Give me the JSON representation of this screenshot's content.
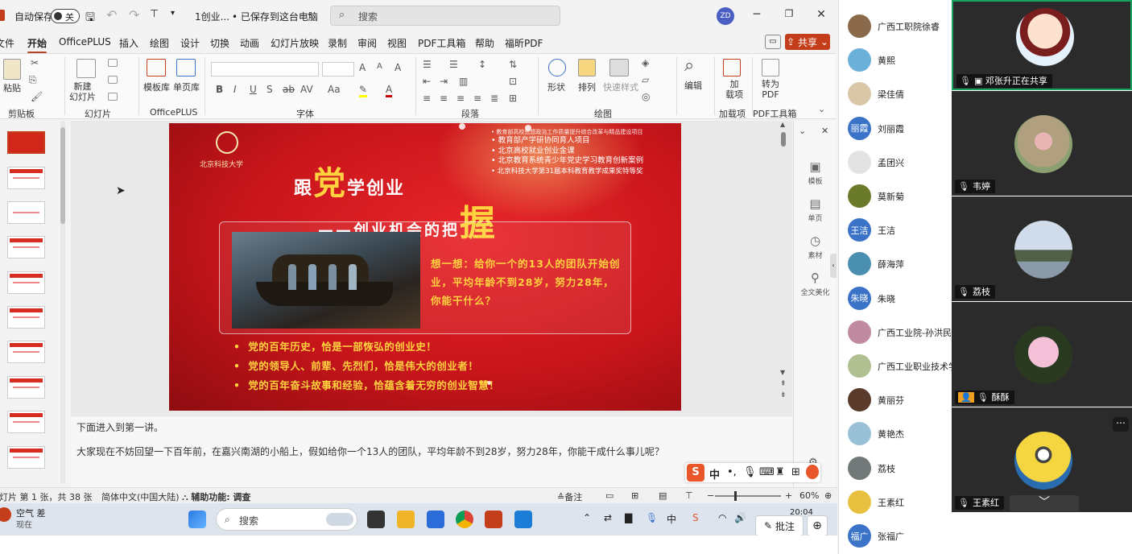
{
  "ppt": {
    "titlebar": {
      "autosave_label": "自动保存",
      "autosave_state": "关",
      "doc_name": "1创业...",
      "save_status": "• 已保存到这台电脑",
      "search_placeholder": "搜索",
      "user_initials": "ZD"
    },
    "menu": [
      "文件",
      "开始",
      "OfficePLUS",
      "插入",
      "绘图",
      "设计",
      "切换",
      "动画",
      "幻灯片放映",
      "录制",
      "审阅",
      "视图",
      "PDF工具箱",
      "帮助",
      "福昕PDF"
    ],
    "share_label": "共享",
    "ribbon": {
      "paste": "粘贴",
      "new_slide": "新建\n幻灯片",
      "template_lib": "模板库",
      "single_page": "单页库",
      "shape": "形状",
      "arrange": "排列",
      "quick_style": "快速样式",
      "edit": "编辑",
      "addin": "加\n载项",
      "to_pdf": "转为\nPDF",
      "groups": [
        "剪贴板",
        "幻灯片",
        "OfficePLUS",
        "字体",
        "段落",
        "绘图",
        "加载项",
        "PDF工具箱"
      ]
    },
    "slide": {
      "logo_text": "北京科技大学",
      "title_prefix": "跟",
      "title_big": "党",
      "title_suffix": "学创业",
      "subtitle_prefix": "——创业机会的把",
      "subtitle_big": "握",
      "top_bullets": [
        "教育部高校思想政治工作质量提升综合改革与精品建设项目",
        "教育部产学研协同育人项目",
        "北京高校就业创业金课",
        "北京教育系统青少年党史学习教育创新案例",
        "北京科技大学第31届本科教育教学成果奖特等奖"
      ],
      "think_text": "想一想：给你一个的13人的团队开始创业，平均年龄不到28岁，努力28年，你能干什么？",
      "bottom_bullets": [
        "党的百年历史，恰是一部恢弘的创业史！",
        "党的领导人、前辈、先烈们，恰是伟大的创业者！",
        "党的百年奋斗故事和经验，恰蕴含着无穷的创业智慧！"
      ]
    },
    "notes": {
      "line1": "下面进入到第一讲。",
      "line2": "大家现在不妨回望一下百年前，在嘉兴南湖的小船上，假如给你一个13人的团队，平均年龄不到28岁，努力28年，你能干成什么事儿呢？"
    },
    "side_panel": [
      "模板",
      "单页",
      "素材",
      "全文美化"
    ],
    "status": {
      "slide_info": "幻灯片 第 1 张，共 38 张",
      "language": "简体中文(中国大陆)",
      "accessibility": "辅助功能: 调查",
      "notes_btn": "备注",
      "zoom": "60%"
    },
    "taskbar": {
      "weather": "空气 差",
      "weather_sub": "现在",
      "search": "搜索",
      "time": "20:04"
    },
    "ime": [
      "中",
      "•,"
    ],
    "annot_label": "批注"
  },
  "participants": [
    {
      "name": "广西工职院徐睿",
      "color": "#8a6a4a",
      "initials": ""
    },
    {
      "name": "黄熙",
      "color": "#6bb0d8",
      "initials": ""
    },
    {
      "name": "梁佳倩",
      "color": "#d9c7a8",
      "initials": ""
    },
    {
      "name": "刘丽霞",
      "color": "#3b73c9",
      "initials": "丽霞"
    },
    {
      "name": "孟团兴",
      "color": "#e3e3e3",
      "initials": ""
    },
    {
      "name": "莫新菊",
      "color": "#6a7a2a",
      "initials": ""
    },
    {
      "name": "王洁",
      "color": "#3b73c9",
      "initials": "王洁"
    },
    {
      "name": "薛海萍",
      "color": "#4a8fb0",
      "initials": ""
    },
    {
      "name": "朱晓",
      "color": "#3b73c9",
      "initials": "朱晓"
    },
    {
      "name": "广西工业院-孙洪民",
      "color": "#c08aa0",
      "initials": ""
    },
    {
      "name": "广西工业职业技术学",
      "color": "#b0c090",
      "initials": ""
    },
    {
      "name": "黄丽芬",
      "color": "#5a3a2a",
      "initials": ""
    },
    {
      "name": "黄艳杰",
      "color": "#9ac0d8",
      "initials": ""
    },
    {
      "name": "荔枝",
      "color": "#707878",
      "initials": ""
    },
    {
      "name": "王素红",
      "color": "#e8c040",
      "initials": ""
    },
    {
      "name": "张福广",
      "color": "#3b73c9",
      "initials": "福广"
    }
  ],
  "videos": [
    {
      "name": "邓张升正在共享",
      "active": true
    },
    {
      "name": "韦婷",
      "active": false
    },
    {
      "name": "荔枝",
      "active": false
    },
    {
      "name": "酥酥",
      "active": false
    },
    {
      "name": "王素红",
      "active": false
    }
  ]
}
